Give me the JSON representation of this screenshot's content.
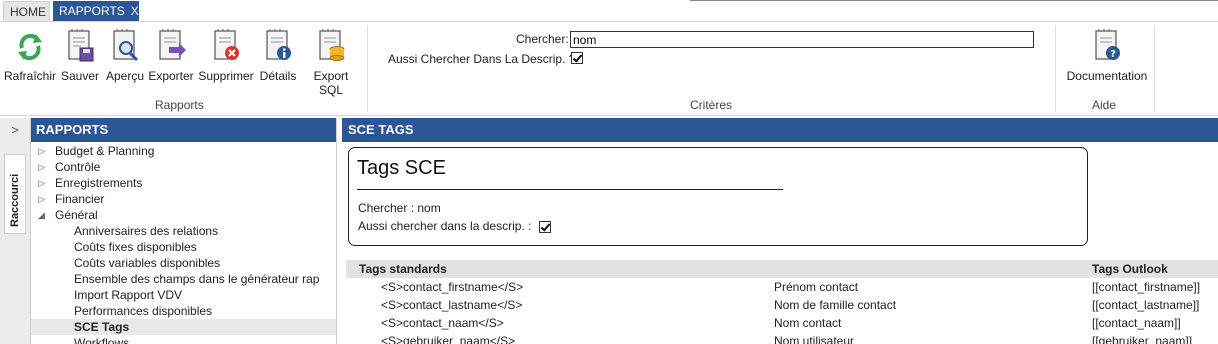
{
  "tabs": {
    "home": "HOME",
    "rapports": "RAPPORTS",
    "rapports_close": "X"
  },
  "ribbon": {
    "buttons": {
      "refresh": "Rafraîchir",
      "save": "Sauver",
      "preview": "Aperçu",
      "export": "Exporter",
      "delete": "Supprimer",
      "details": "Détails",
      "export_sql": "Export SQL",
      "documentation": "Documentation"
    },
    "groups": {
      "rapports": "Rapports",
      "criteres": "Critères",
      "aide": "Aide"
    },
    "criteria": {
      "search_label": "Chercher:",
      "search_value": "nom",
      "desc_label": "Aussi Chercher Dans La Descrip. ?:",
      "desc_checked": true
    }
  },
  "sidebar": {
    "toggle": ">",
    "tab_label": "Raccourci"
  },
  "tree": {
    "header": "RAPPORTS",
    "items": [
      {
        "label": "Budget & Planning",
        "arrow": "▷"
      },
      {
        "label": "Contrôle",
        "arrow": "▷"
      },
      {
        "label": "Enregistrements",
        "arrow": "▷"
      },
      {
        "label": "Financier",
        "arrow": "▷"
      },
      {
        "label": "Général",
        "arrow": "◢"
      },
      {
        "label": "Anniversaires des relations",
        "arrow": ""
      },
      {
        "label": "Coûts fixes disponibles",
        "arrow": ""
      },
      {
        "label": "Coûts variables disponibles",
        "arrow": ""
      },
      {
        "label": "Ensemble des champs dans le générateur rap",
        "arrow": ""
      },
      {
        "label": "Import Rapport VDV",
        "arrow": ""
      },
      {
        "label": "Performances disponibles",
        "arrow": ""
      },
      {
        "label": "SCE Tags",
        "arrow": ""
      },
      {
        "label": "Workflows",
        "arrow": ""
      }
    ]
  },
  "report": {
    "header": "SCE TAGS",
    "card": {
      "title": "Tags SCE",
      "search_line": "Chercher : nom",
      "desc_line": "Aussi chercher dans la descrip. :"
    },
    "table": {
      "columns": [
        "Tags standards",
        "Tags Outlook"
      ],
      "rows": [
        {
          "tag": "<S>contact_firstname</S>",
          "desc": "Prénom contact",
          "outlook": "[[contact_firstname]]"
        },
        {
          "tag": "<S>contact_lastname</S>",
          "desc": "Nom de famille contact",
          "outlook": "[[contact_lastname]]"
        },
        {
          "tag": "<S>contact_naam</S>",
          "desc": "Nom contact",
          "outlook": "[[contact_naam]]"
        },
        {
          "tag": "<S>gebruiker_naam</S>",
          "desc": "Nom utilisateur",
          "outlook": "[[gebruiker_naam]]"
        }
      ]
    }
  },
  "colors": {
    "header_blue": "#2b5797",
    "table_head_gray": "#e2e2e2"
  }
}
